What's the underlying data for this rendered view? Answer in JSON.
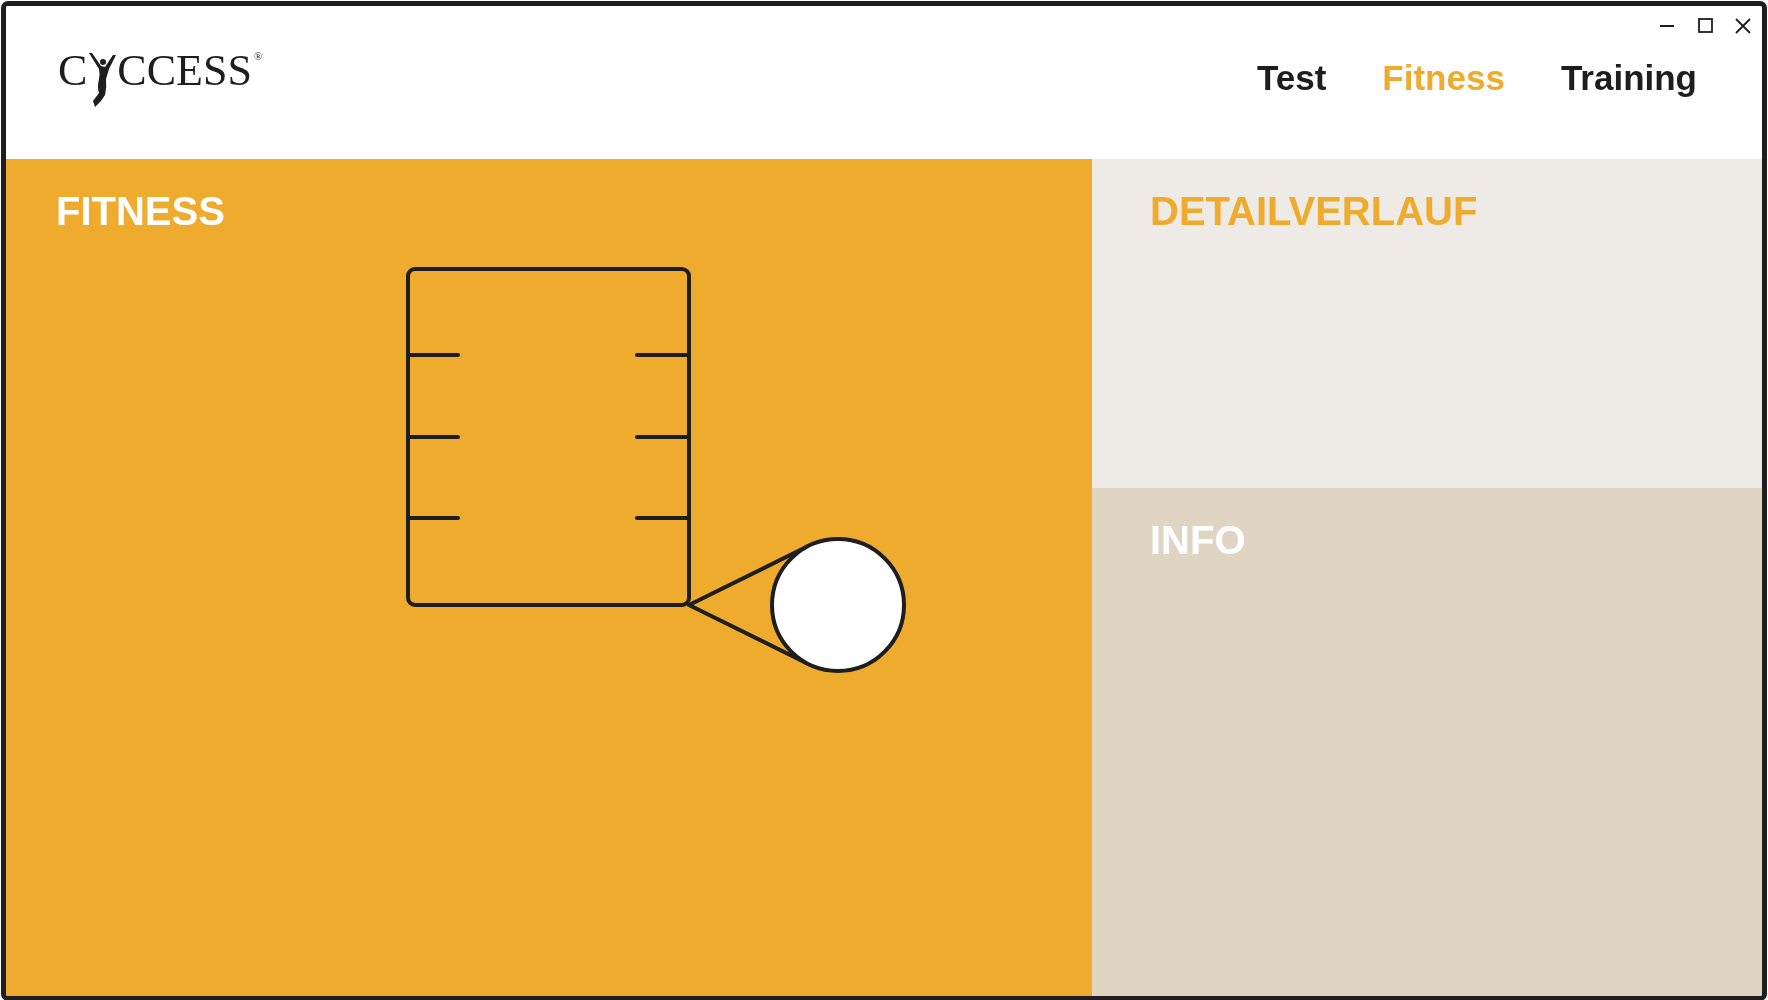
{
  "logo": {
    "lead": "C",
    "tail": "CCESS",
    "mark": "®"
  },
  "window_controls": [
    {
      "kind": "minimize"
    },
    {
      "kind": "maximize"
    },
    {
      "kind": "close"
    }
  ],
  "tabs": [
    {
      "label": "Test",
      "selected": false
    },
    {
      "label": "Fitness",
      "selected": true
    },
    {
      "label": "Training",
      "selected": false
    }
  ],
  "panels": {
    "fitness": {
      "title": "FITNESS"
    },
    "detail": {
      "title": "DETAILVERLAUF"
    },
    "info": {
      "title": "INFO"
    }
  }
}
